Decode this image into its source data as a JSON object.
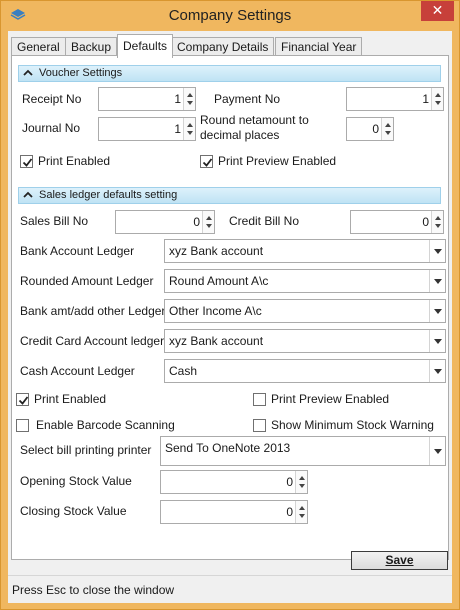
{
  "window": {
    "title": "Company Settings",
    "close_glyph": "✕"
  },
  "tabs": [
    "General",
    "Backup",
    "Defaults",
    "Company Details",
    "Financial Year"
  ],
  "voucher": {
    "header": "Voucher Settings",
    "receipt_label": "Receipt No",
    "receipt_value": "1",
    "payment_label": "Payment No",
    "payment_value": "1",
    "journal_label": "Journal No",
    "journal_value": "1",
    "round_label_1": "Round netamount to",
    "round_label_2": "decimal places",
    "round_value": "0",
    "print_enabled": {
      "label": "Print Enabled",
      "checked": true
    },
    "print_preview": {
      "label": "Print Preview Enabled",
      "checked": true
    }
  },
  "sales": {
    "header": "Sales ledger defaults setting",
    "sales_bill_label": "Sales Bill No",
    "sales_bill_value": "0",
    "credit_bill_label": "Credit Bill No",
    "credit_bill_value": "0",
    "bank_account_label": "Bank Account Ledger",
    "bank_account_value": "xyz Bank account",
    "rounded_label": "Rounded Amount Ledger",
    "rounded_value": "Round Amount A\\c",
    "bank_amt_label": "Bank amt/add other Ledger",
    "bank_amt_value": "Other Income A\\c",
    "credit_card_label": "Credit Card Account ledger",
    "credit_card_value": "xyz Bank account",
    "cash_label": "Cash Account Ledger",
    "cash_value": "Cash",
    "print_enabled": {
      "label": "Print Enabled",
      "checked": true
    },
    "print_preview": {
      "label": "Print Preview Enabled",
      "checked": false
    },
    "barcode": {
      "label": "Enable Barcode Scanning",
      "checked": false
    },
    "min_stock": {
      "label": "Show Minimum Stock Warning",
      "checked": false
    },
    "printer_label": "Select bill printing printer",
    "printer_value": "Send To OneNote 2013",
    "opening_stock_label": "Opening Stock Value",
    "opening_stock_value": "0",
    "closing_stock_label": "Closing Stock Value",
    "closing_stock_value": "0"
  },
  "save_label": "Save",
  "status": "Press Esc to close the window",
  "colors": {
    "frame": "#f0b75f",
    "close": "#c7403a",
    "section": "#bfe3f4"
  },
  "icons": [
    "app-icon",
    "close-icon",
    "chevron-up-icon",
    "spin-up-icon",
    "spin-down-icon",
    "dropdown-arrow-icon",
    "checkmark-icon"
  ]
}
